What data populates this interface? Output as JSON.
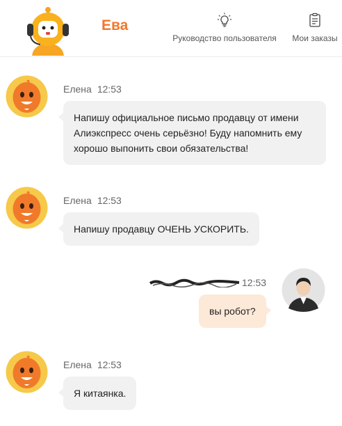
{
  "header": {
    "bot_name": "Ева",
    "links": {
      "guide_label": "Руководство пользователя",
      "orders_label": "Мои заказы"
    },
    "icons": {
      "guide": "lightbulb-icon",
      "orders": "clipboard-icon"
    },
    "accent_color": "#f4762a"
  },
  "messages": [
    {
      "side": "left",
      "author": "Елена",
      "time": "12:53",
      "text": "Напишу официальное письмо продавцу от имени Алиэкспресс очень серьёзно! Буду напомнить ему хорошо выпонить свои обязательства!"
    },
    {
      "side": "left",
      "author": "Елена",
      "time": "12:53",
      "text": "Напишу продавцу ОЧЕНЬ УСКОРИТЬ."
    },
    {
      "side": "right",
      "author": "",
      "time": "12:53",
      "text": "вы робот?"
    },
    {
      "side": "left",
      "author": "Елена",
      "time": "12:53",
      "text": "Я китаянка."
    }
  ],
  "colors": {
    "agent_bubble": "#f1f1f1",
    "user_bubble": "#fde9d8"
  }
}
